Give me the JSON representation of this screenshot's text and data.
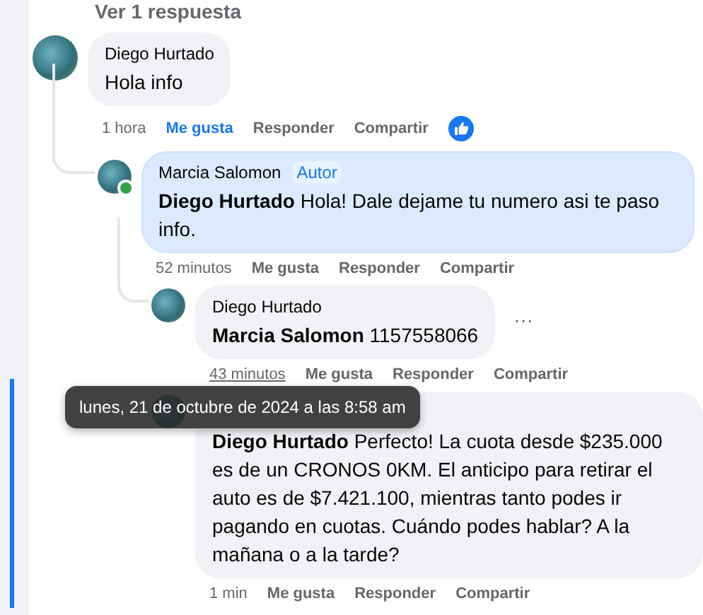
{
  "view_replies": "Ver 1 respuesta",
  "comments": [
    {
      "author": "Diego Hurtado",
      "text": "Hola info",
      "time": "1 hora",
      "like_label": "Me gusta",
      "liked": true,
      "reply_label": "Responder",
      "share_label": "Compartir",
      "has_like_reaction": true,
      "children": [
        {
          "author": "Marcia Salomon",
          "author_badge": "Autor",
          "online": true,
          "highlighted": true,
          "text": "**Diego Hurtado** Hola! Dale dejame tu numero asi te paso info.",
          "time": "52 minutos",
          "like_label": "Me gusta",
          "liked": false,
          "reply_label": "Responder",
          "share_label": "Compartir",
          "children": [
            {
              "author": "Diego Hurtado",
              "text": "**Marcia Salomon** 1157558066",
              "menu": "···",
              "time": "43 minutos",
              "time_hovered": true,
              "like_label": "Me gusta",
              "liked": false,
              "reply_label": "Responder",
              "share_label": "Compartir"
            },
            {
              "tooltip": "lunes, 21 de octubre de 2024 a las 8:58 am",
              "text": "**Diego Hurtado** Perfecto! La cuota desde $235.000 es de un CRONOS 0KM. El anticipo para retirar el auto es de $7.421.100, mientras tanto podes ir pagando en cuotas. Cuándo podes hablar? A la mañana o a la tarde?",
              "time": "1 min",
              "like_label": "Me gusta",
              "liked": false,
              "reply_label": "Responder",
              "share_label": "Compartir"
            }
          ]
        }
      ]
    }
  ]
}
